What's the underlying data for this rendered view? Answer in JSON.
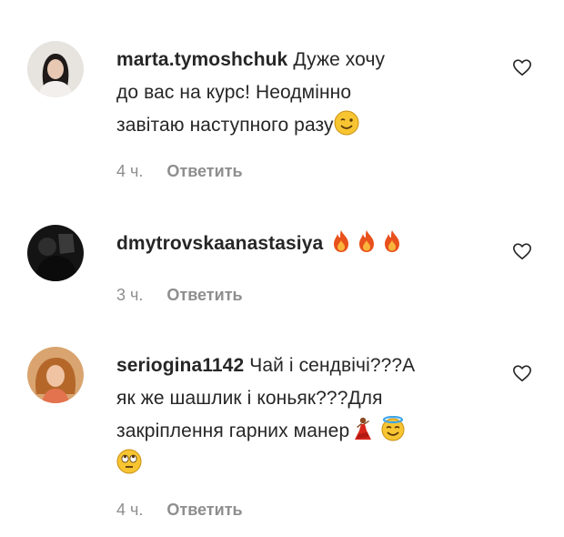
{
  "comments": [
    {
      "username": "marta.tymoshchuk",
      "line1": "Дуже хочу",
      "line2": "до вас на курс! Неодмінно",
      "line3": "завітаю наступного разу",
      "emoji": [
        "smiling-face-emoji"
      ],
      "time": "4 ч.",
      "reply": "Ответить"
    },
    {
      "username": "dmytrovskaanastasiya",
      "line1": "",
      "emoji": [
        "fire-emoji",
        "fire-emoji",
        "fire-emoji"
      ],
      "time": "3 ч.",
      "reply": "Ответить"
    },
    {
      "username": "seriogina1142",
      "line1": "Чай і сендвічі???А",
      "line2": "як же шашлик і коньяк???Для",
      "line3": "закріплення гарних манер",
      "emoji": [
        "dancer-emoji",
        "halo-face-emoji",
        "eye-roll-emoji"
      ],
      "time": "4 ч.",
      "reply": "Ответить"
    }
  ],
  "colors": {
    "text": "#262626",
    "meta": "#8e8e8e",
    "background": "#ffffff"
  }
}
